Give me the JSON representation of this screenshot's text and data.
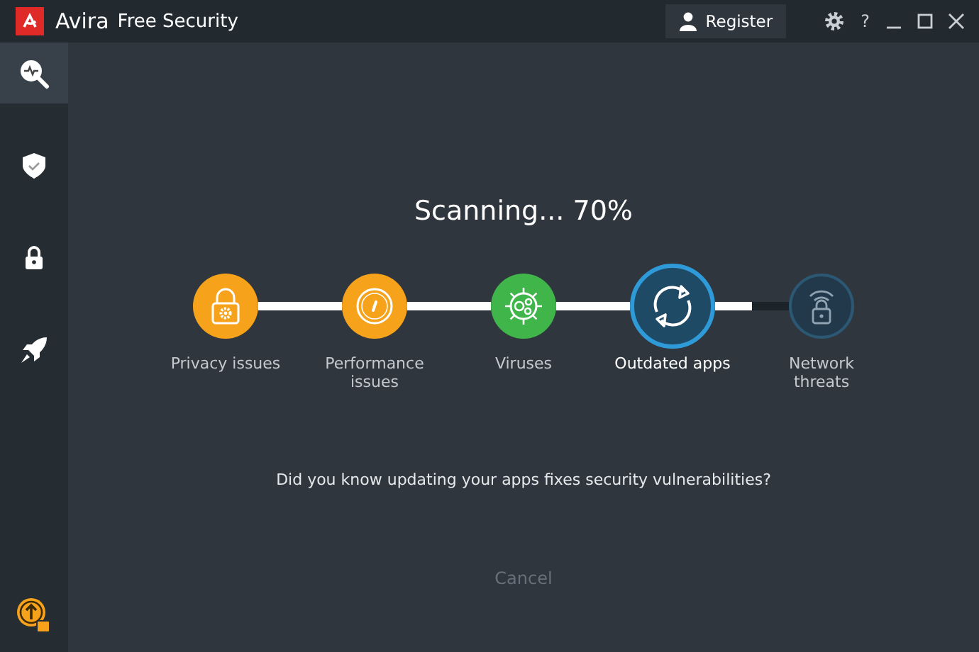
{
  "window": {
    "brand": "Avira",
    "title": "Free Security",
    "register_label": "Register",
    "help": "?"
  },
  "sidebar": {
    "items": [
      {
        "kind": "scan",
        "selected": true
      },
      {
        "kind": "shield",
        "selected": false
      },
      {
        "kind": "lock",
        "selected": false
      },
      {
        "kind": "rocket",
        "selected": false
      }
    ]
  },
  "scan": {
    "title": "Scanning... 70%",
    "steps": [
      {
        "kind": "lock-gear",
        "label": "Privacy issues",
        "completed": true,
        "current": false,
        "color": "#f7a21b"
      },
      {
        "kind": "gauge",
        "label": "Performance issues",
        "completed": true,
        "current": false,
        "color": "#f7a21b"
      },
      {
        "kind": "virus",
        "label": "Viruses",
        "completed": true,
        "current": false,
        "color": "#3fb54a"
      },
      {
        "kind": "sync",
        "label": "Outdated apps",
        "completed": false,
        "current": true
      },
      {
        "kind": "wifi-lock",
        "label": "Network threats",
        "completed": false,
        "current": false
      }
    ],
    "connectors": [
      {
        "level": 1
      },
      {
        "level": 1
      },
      {
        "level": 1
      },
      {
        "level": 0.5
      }
    ],
    "tip": "Did you know updating your apps fixes security vulnerabilities?",
    "cancel": {
      "label": "Cancel",
      "disabled": true
    }
  }
}
